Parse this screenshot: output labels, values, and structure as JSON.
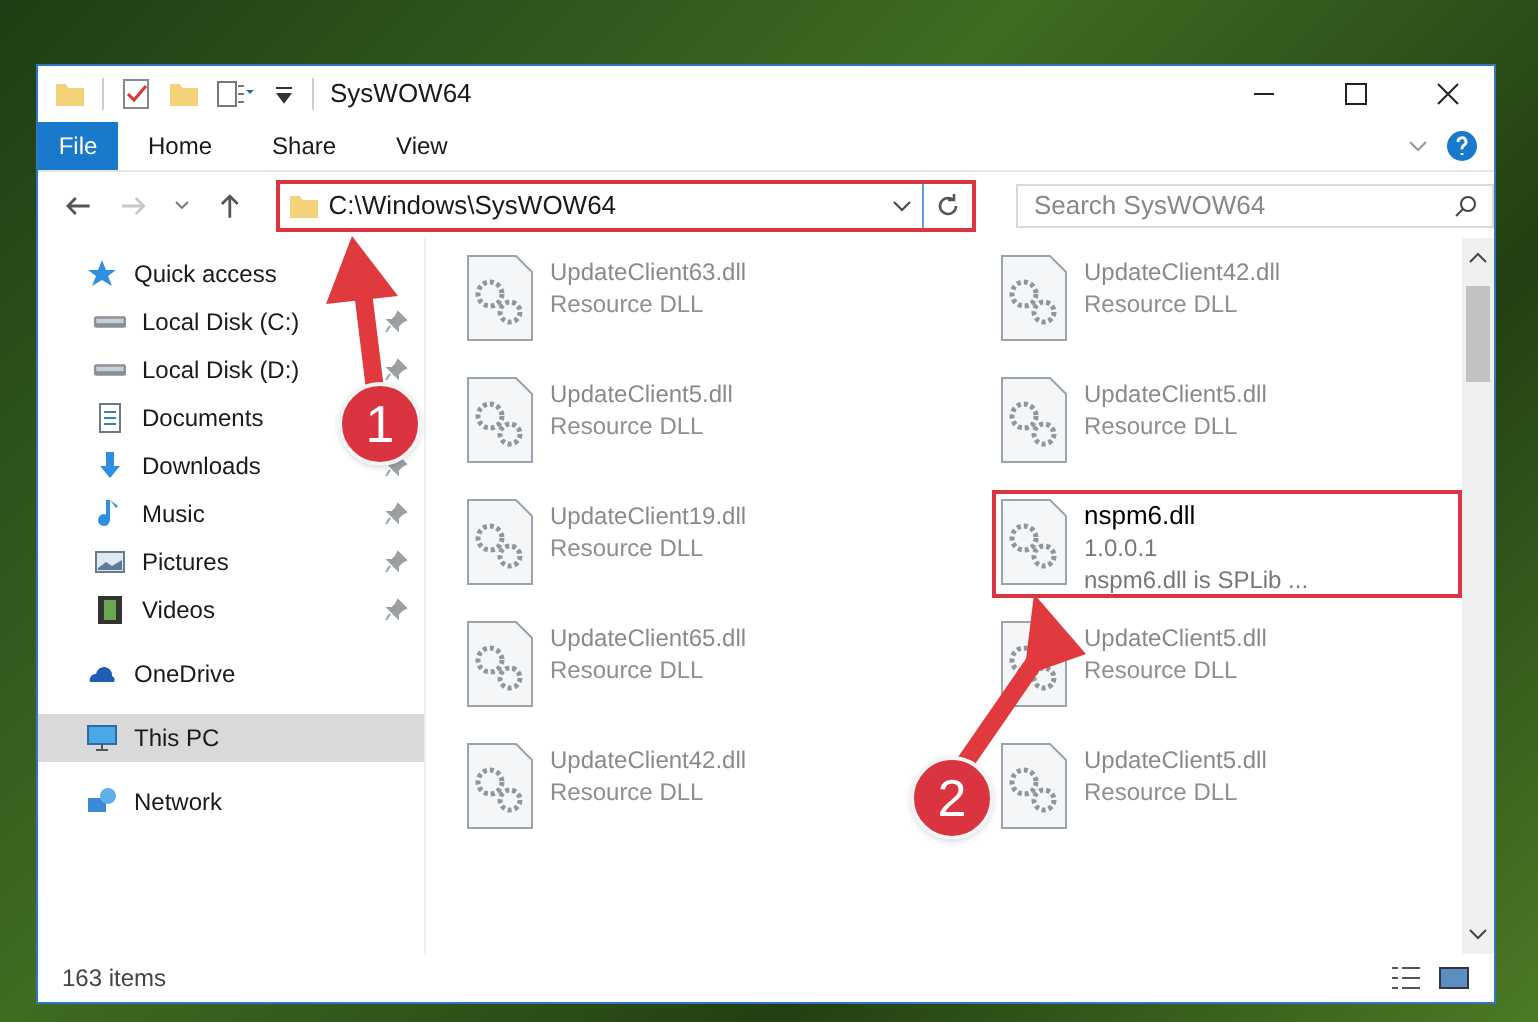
{
  "window": {
    "title": "SysWOW64"
  },
  "ribbon_tabs": [
    {
      "label": "File",
      "kind": "file"
    },
    {
      "label": "Home",
      "kind": "tab"
    },
    {
      "label": "Share",
      "kind": "tab"
    },
    {
      "label": "View",
      "kind": "tab"
    }
  ],
  "address_bar": {
    "path": "C:\\Windows\\SysWOW64",
    "highlighted": true
  },
  "search": {
    "placeholder": "Search SysWOW64"
  },
  "sidebar": {
    "items": [
      {
        "label": "Quick access",
        "kind": "star",
        "selected": false,
        "children": [
          {
            "label": "Local Disk (C:)",
            "kind": "drive",
            "pinned": true
          },
          {
            "label": "Local Disk (D:)",
            "kind": "drive",
            "pinned": true
          },
          {
            "label": "Documents",
            "kind": "documents",
            "pinned": false
          },
          {
            "label": "Downloads",
            "kind": "download",
            "pinned": true
          },
          {
            "label": "Music",
            "kind": "music",
            "pinned": true
          },
          {
            "label": "Pictures",
            "kind": "pictures",
            "pinned": true
          },
          {
            "label": "Videos",
            "kind": "videos",
            "pinned": true
          }
        ]
      },
      {
        "label": "OneDrive",
        "kind": "cloud",
        "selected": false
      },
      {
        "label": "This PC",
        "kind": "pc",
        "selected": true
      },
      {
        "label": "Network",
        "kind": "network",
        "selected": false
      }
    ]
  },
  "files": [
    {
      "name": "UpdateClient63.dll",
      "type": "Resource DLL",
      "highlighted": false
    },
    {
      "name": "UpdateClient42.dll",
      "type": "Resource DLL",
      "highlighted": false
    },
    {
      "name": "UpdateClient5.dll",
      "type": "Resource DLL",
      "highlighted": false
    },
    {
      "name": "UpdateClient5.dll",
      "type": "Resource DLL",
      "highlighted": false
    },
    {
      "name": "UpdateClient19.dll",
      "type": "Resource DLL",
      "highlighted": false
    },
    {
      "name": "nspm6.dll",
      "version": "1.0.0.1",
      "description": "nspm6.dll is SPLib ...",
      "highlighted": true
    },
    {
      "name": "UpdateClient65.dll",
      "type": "Resource DLL",
      "highlighted": false
    },
    {
      "name": "UpdateClient5.dll",
      "type": "Resource DLL",
      "highlighted": false
    },
    {
      "name": "UpdateClient42.dll",
      "type": "Resource DLL",
      "highlighted": false
    },
    {
      "name": "UpdateClient5.dll",
      "type": "Resource DLL",
      "highlighted": false
    }
  ],
  "status_bar": {
    "item_count": "163 items"
  },
  "annotations": [
    {
      "label": "1"
    },
    {
      "label": "2"
    }
  ]
}
